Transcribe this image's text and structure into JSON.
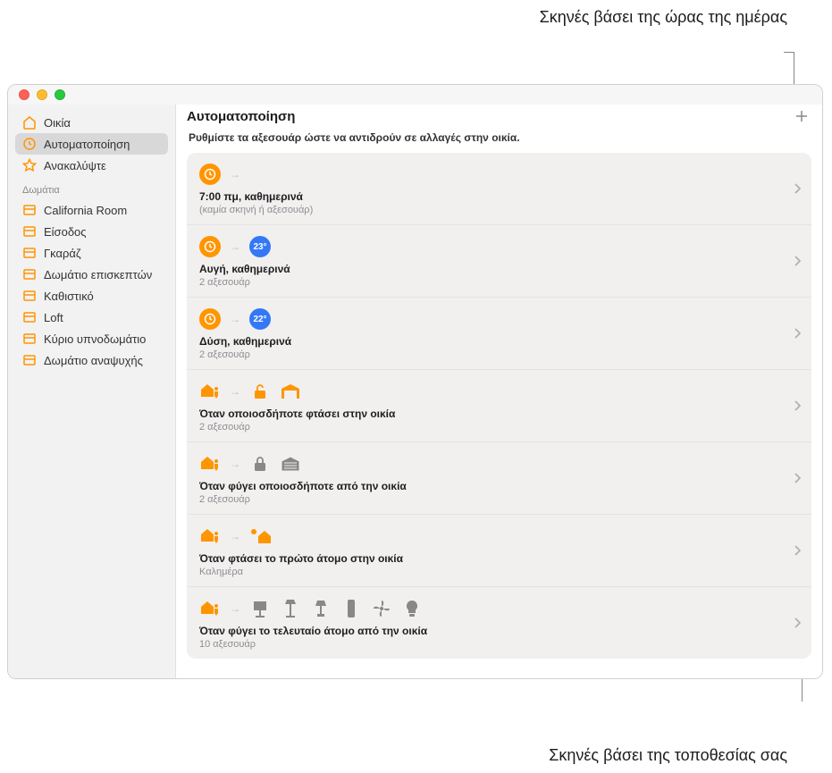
{
  "annotations": {
    "top": "Σκηνές βάσει της ώρας της ημέρας",
    "bottom": "Σκηνές βάσει της τοποθεσίας σας"
  },
  "header": {
    "title": "Αυτοματοποίηση",
    "subtitle": "Ρυθμίστε τα αξεσουάρ ώστε να αντιδρούν σε αλλαγές στην οικία."
  },
  "sidebar": {
    "primary": [
      {
        "label": "Οικία",
        "icon": "house"
      },
      {
        "label": "Αυτοματοποίηση",
        "icon": "clock-check",
        "selected": true
      },
      {
        "label": "Ανακαλύψτε",
        "icon": "star"
      }
    ],
    "section_header": "Δωμάτια",
    "rooms": [
      {
        "label": "California Room"
      },
      {
        "label": "Είσοδος"
      },
      {
        "label": "Γκαράζ"
      },
      {
        "label": "Δωμάτιο επισκεπτών"
      },
      {
        "label": "Καθιστικό"
      },
      {
        "label": "Loft"
      },
      {
        "label": "Κύριο υπνοδωμάτιο"
      },
      {
        "label": "Δωμάτιο αναψυχής"
      }
    ]
  },
  "automations": [
    {
      "title": "7:00 πμ, καθημερινά",
      "sub": "(καμία σκηνή ή αξεσουάρ)",
      "icons": [
        "clock"
      ],
      "temp": null
    },
    {
      "title": "Αυγή, καθημερινά",
      "sub": "2 αξεσουάρ",
      "icons": [
        "clock"
      ],
      "temp": "23°"
    },
    {
      "title": "Δύση, καθημερινά",
      "sub": "2 αξεσουάρ",
      "icons": [
        "clock"
      ],
      "temp": "22°"
    },
    {
      "title": "Όταν οποιοσδήποτε φτάσει στην οικία",
      "sub": "2 αξεσουάρ",
      "icons": [
        "house-person"
      ],
      "accessories": [
        "unlock",
        "garage"
      ]
    },
    {
      "title": "Όταν φύγει οποιοσδήποτε από την οικία",
      "sub": "2 αξεσουάρ",
      "icons": [
        "house-person-away"
      ],
      "accessories": [
        "lock",
        "garage-closed"
      ]
    },
    {
      "title": "Όταν φτάσει το πρώτο άτομο στην οικία",
      "sub": "Καλημέρα",
      "icons": [
        "house-person"
      ],
      "accessories": [
        "house-sunny"
      ]
    },
    {
      "title": "Όταν φύγει το τελευταίο άτομο από την οικία",
      "sub": "10 αξεσουάρ",
      "icons": [
        "house-person-away"
      ],
      "accessories": [
        "screen",
        "lamp1",
        "lamp2",
        "remote",
        "fan",
        "bulb"
      ]
    }
  ]
}
